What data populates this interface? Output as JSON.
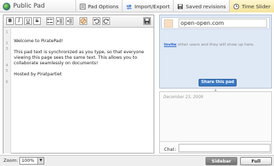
{
  "header": {
    "brand": "Public Pad",
    "menu": [
      {
        "label": "Pad Options",
        "icon": "pad-options-icon"
      },
      {
        "label": "Import/Export",
        "icon": "import-export-icon"
      },
      {
        "label": "Saved revisions",
        "icon": "save-icon"
      },
      {
        "label": "Time Slider",
        "icon": "time-slider-icon"
      }
    ]
  },
  "toolbar": {
    "bold": "B",
    "italic": "I",
    "underline": "U",
    "strikethrough": "S"
  },
  "editor": {
    "line_numbers": [
      "1",
      "2",
      "3",
      "4",
      "5",
      "6"
    ],
    "lines": [
      "Welcome to PiratePad!",
      "",
      "This pad text is synchronized as you type, so that everyone",
      "viewing this page sees the same text.  This allows you to",
      "collaborate seamlessly on documents!",
      "",
      "Hosted by Piratpartiet"
    ]
  },
  "users": {
    "name_value": "open-open.com",
    "invite_link": "Invite",
    "invite_text": " other users and they will show up here.",
    "share_button": "Share this pad"
  },
  "chat": {
    "date": "December 23, 2009",
    "label": "Chat:"
  },
  "footer": {
    "zoom_label": "Zoom:",
    "zoom_value": "100%",
    "sidebar_button": "Sidebar",
    "fullwindow_button": "Full Window"
  },
  "colors": {
    "accent": "#3a78c2",
    "panel": "#dfe8f5",
    "user_swatch": "#f6dfc4",
    "active_tab": "#f4e39a"
  }
}
